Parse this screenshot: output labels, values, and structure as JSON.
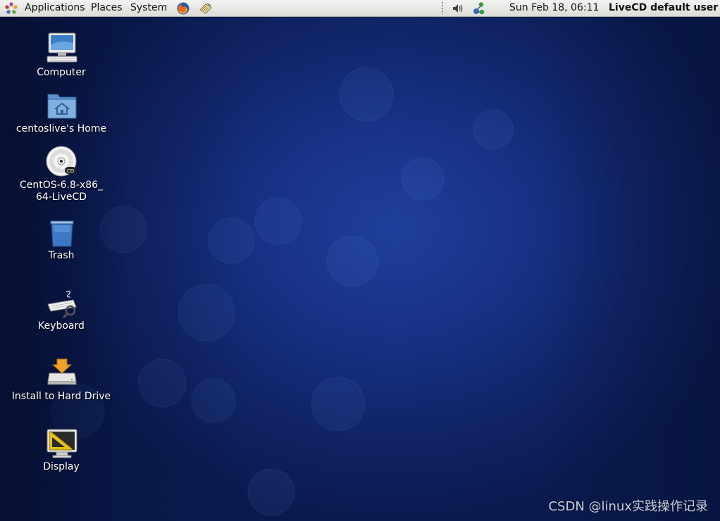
{
  "panel": {
    "menus": [
      "Applications",
      "Places",
      "System"
    ],
    "clock": "Sun Feb 18, 06:11",
    "user": "LiveCD default user",
    "icons": [
      "gnome-foot-icon",
      "firefox-icon",
      "text-editor-icon",
      "volume-icon",
      "network-icon"
    ]
  },
  "desktop": {
    "icons": [
      {
        "label": "Computer",
        "icon": "computer-icon"
      },
      {
        "label": "centoslive's Home",
        "icon": "home-folder-icon"
      },
      {
        "label": "CentOS-6.8-x86_",
        "label2": "64-LiveCD",
        "icon": "cd-icon"
      },
      {
        "label": "Trash",
        "icon": "trash-icon"
      },
      {
        "label": "Keyboard",
        "icon": "keyboard-icon"
      },
      {
        "label": "Install to Hard Drive",
        "icon": "install-drive-icon"
      },
      {
        "label": "Display",
        "icon": "display-icon"
      }
    ]
  },
  "watermark": "CSDN @linux实践操作记录",
  "colors": {
    "panel_bg": "#dcdcd8",
    "desktop_bg": "#183287"
  }
}
